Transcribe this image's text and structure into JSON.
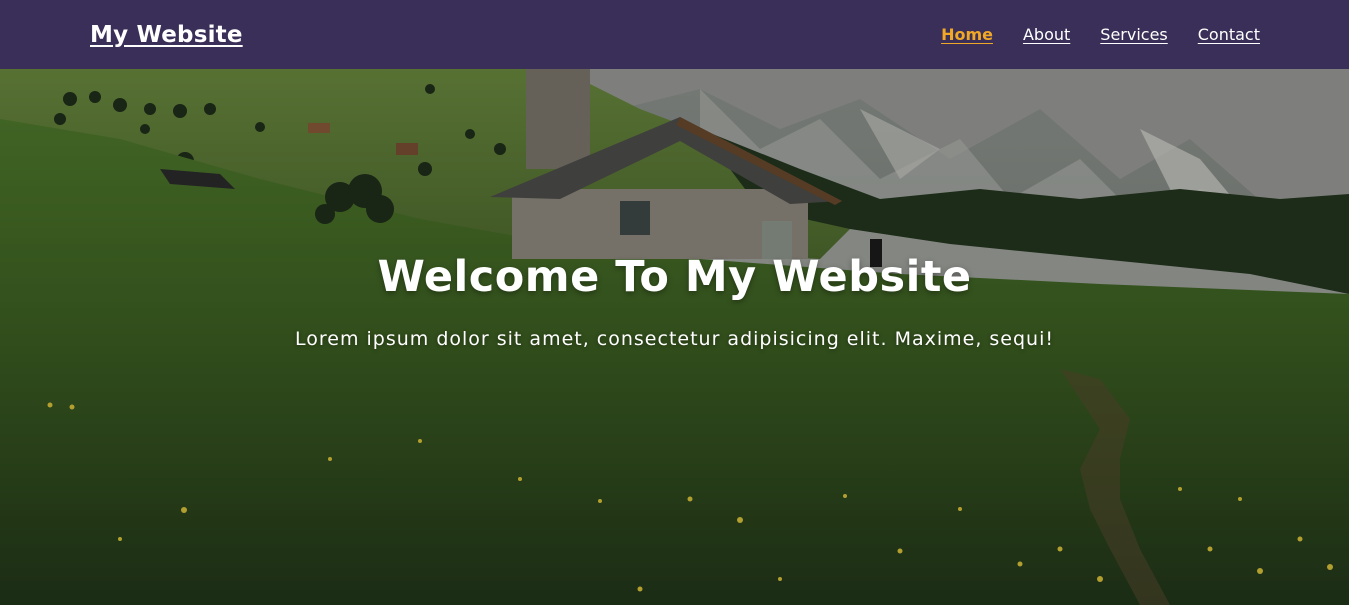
{
  "nav": {
    "brand": "My Website",
    "links": [
      {
        "label": "Home",
        "active": true
      },
      {
        "label": "About",
        "active": false
      },
      {
        "label": "Services",
        "active": false
      },
      {
        "label": "Contact",
        "active": false
      }
    ]
  },
  "hero": {
    "title": "Welcome To My Website",
    "subtitle": "Lorem ipsum dolor sit amet, consectetur adipisicing elit. Maxime, sequi!",
    "image": "mountain-meadow-stone-cottage"
  },
  "colors": {
    "navbar_bg": "#3a2f58",
    "active_link": "#f0a826",
    "text": "#ffffff"
  }
}
